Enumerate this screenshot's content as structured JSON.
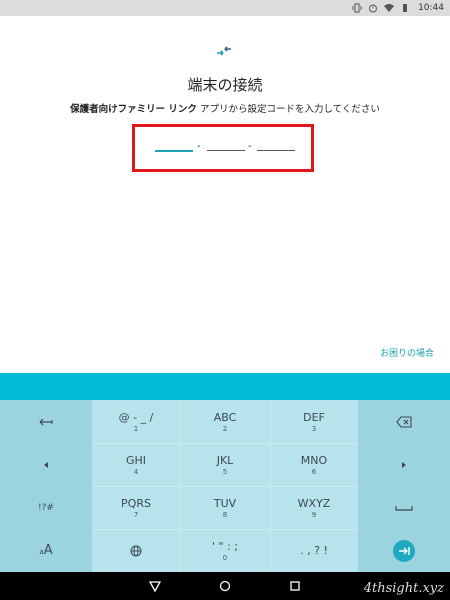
{
  "status_bar": {
    "time": "10:44"
  },
  "screen": {
    "title": "端末の接続",
    "subtitle_bold": "保護者向けファミリー リンク",
    "subtitle_rest": " アプリから設定コードを入力してください",
    "code_separator": "-",
    "help_link": "お困りの場合"
  },
  "keyboard": {
    "rows": [
      {
        "left": "←",
        "keys": [
          {
            "label": "@ - _ /",
            "num": "1"
          },
          {
            "label": "ABC",
            "num": "2"
          },
          {
            "label": "DEF",
            "num": "3"
          }
        ],
        "right": "⌫"
      },
      {
        "left": "◂",
        "keys": [
          {
            "label": "GHI",
            "num": "4"
          },
          {
            "label": "JKL",
            "num": "5"
          },
          {
            "label": "MNO",
            "num": "6"
          }
        ],
        "right": "▸"
      },
      {
        "left": "!?#",
        "keys": [
          {
            "label": "PQRS",
            "num": "7"
          },
          {
            "label": "TUV",
            "num": "8"
          },
          {
            "label": "WXYZ",
            "num": "9"
          }
        ],
        "right": "space"
      },
      {
        "left": "aA",
        "keys": [
          {
            "label": "globe",
            "num": ""
          },
          {
            "label": "' \" : ;",
            "num": "0"
          },
          {
            "label": ". , ? !",
            "num": ""
          }
        ],
        "right": "enter"
      }
    ]
  },
  "watermark": "4thsight.xyz",
  "colors": {
    "accent": "#00bcd4",
    "highlight_box": "#e0161d",
    "link": "#1aa3b5"
  }
}
